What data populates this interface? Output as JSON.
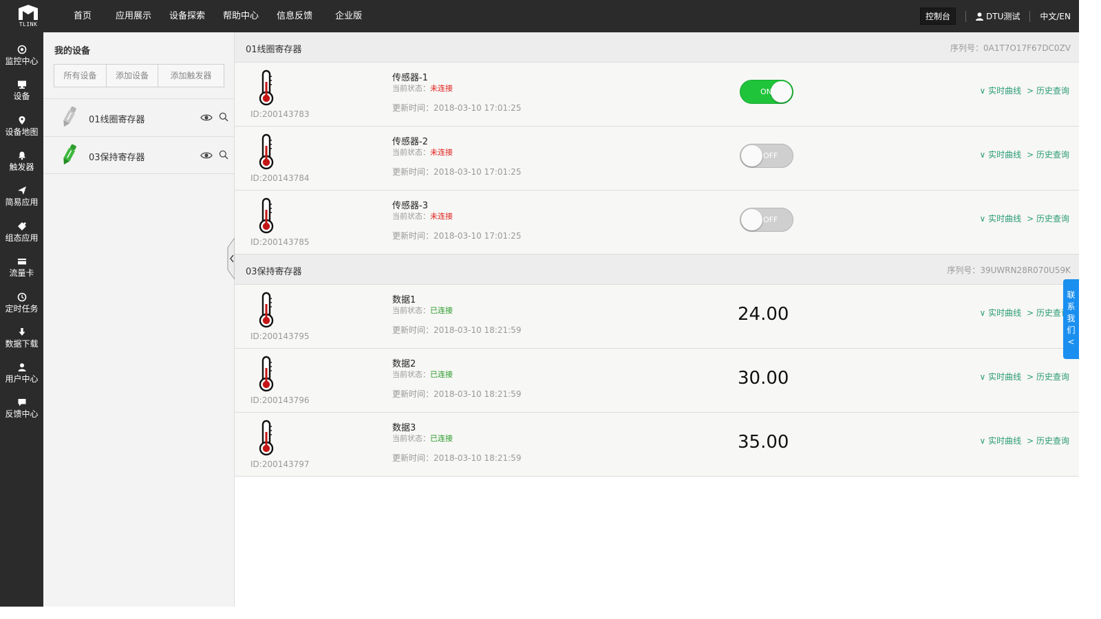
{
  "header": {
    "logo_text": "TLINK",
    "nav": [
      "首页",
      "应用展示",
      "设备探索",
      "帮助中心",
      "信息反馈",
      "企业版"
    ],
    "console_label": "控制台",
    "user_label": "DTU测试",
    "lang_label": "中文/EN"
  },
  "sidebar": {
    "items": [
      {
        "label": "监控中心",
        "icon": "target-icon"
      },
      {
        "label": "设备",
        "icon": "monitor-icon"
      },
      {
        "label": "设备地图",
        "icon": "map-pin-icon"
      },
      {
        "label": "触发器",
        "icon": "bell-icon"
      },
      {
        "label": "简易应用",
        "icon": "send-icon"
      },
      {
        "label": "组态应用",
        "icon": "puzzle-icon"
      },
      {
        "label": "流量卡",
        "icon": "card-icon"
      },
      {
        "label": "定时任务",
        "icon": "clock-icon"
      },
      {
        "label": "数据下载",
        "icon": "download-icon"
      },
      {
        "label": "用户中心",
        "icon": "user-icon"
      },
      {
        "label": "反馈中心",
        "icon": "chat-icon"
      }
    ]
  },
  "device_panel": {
    "title": "我的设备",
    "tabs": [
      "所有设备",
      "添加设备",
      "添加触发器"
    ],
    "devices": [
      {
        "name": "01线圈寄存器",
        "active": false
      },
      {
        "name": "03保持寄存器",
        "active": true
      }
    ]
  },
  "groups": [
    {
      "name": "01线圈寄存器",
      "serial": "序列号：0A1T7O17F67DC0ZV",
      "sensors": [
        {
          "name": "传感器-1",
          "id": "ID:200143783",
          "status_label": "当前状态：",
          "status": "未连接",
          "time": "更新时间：2018-03-10 17:01:25",
          "switch_state": "ON"
        },
        {
          "name": "传感器-2",
          "id": "ID:200143784",
          "status_label": "当前状态：",
          "status": "未连接",
          "time": "更新时间：2018-03-10 17:01:25",
          "switch_state": "OFF"
        },
        {
          "name": "传感器-3",
          "id": "ID:200143785",
          "status_label": "当前状态：",
          "status": "未连接",
          "time": "更新时间：2018-03-10 17:01:25",
          "switch_state": "OFF"
        }
      ]
    },
    {
      "name": "03保持寄存器",
      "serial": "序列号：39UWRN28R070U59K",
      "sensors": [
        {
          "name": "数据1",
          "id": "ID:200143795",
          "status_label": "当前状态：",
          "status": "已连接",
          "time": "更新时间：2018-03-10 18:21:59",
          "value": "24.00"
        },
        {
          "name": "数据2",
          "id": "ID:200143796",
          "status_label": "当前状态：",
          "status": "已连接",
          "time": "更新时间：2018-03-10 18:21:59",
          "value": "30.00"
        },
        {
          "name": "数据3",
          "id": "ID:200143797",
          "status_label": "当前状态：",
          "status": "已连接",
          "time": "更新时间：2018-03-10 18:21:59",
          "value": "35.00"
        }
      ]
    }
  ],
  "row_links": {
    "realtime": "∨ 实时曲线",
    "history": "> 历史查询"
  },
  "contact_tab": {
    "text": "联系我们<"
  },
  "colors": {
    "accent_green": "#1fc43a",
    "link_green": "#2a9b77",
    "status_red": "#e0201c",
    "status_green": "#2a9b2a",
    "contact_blue": "#1a8ff0",
    "dark_bar": "#2b2b2b"
  }
}
